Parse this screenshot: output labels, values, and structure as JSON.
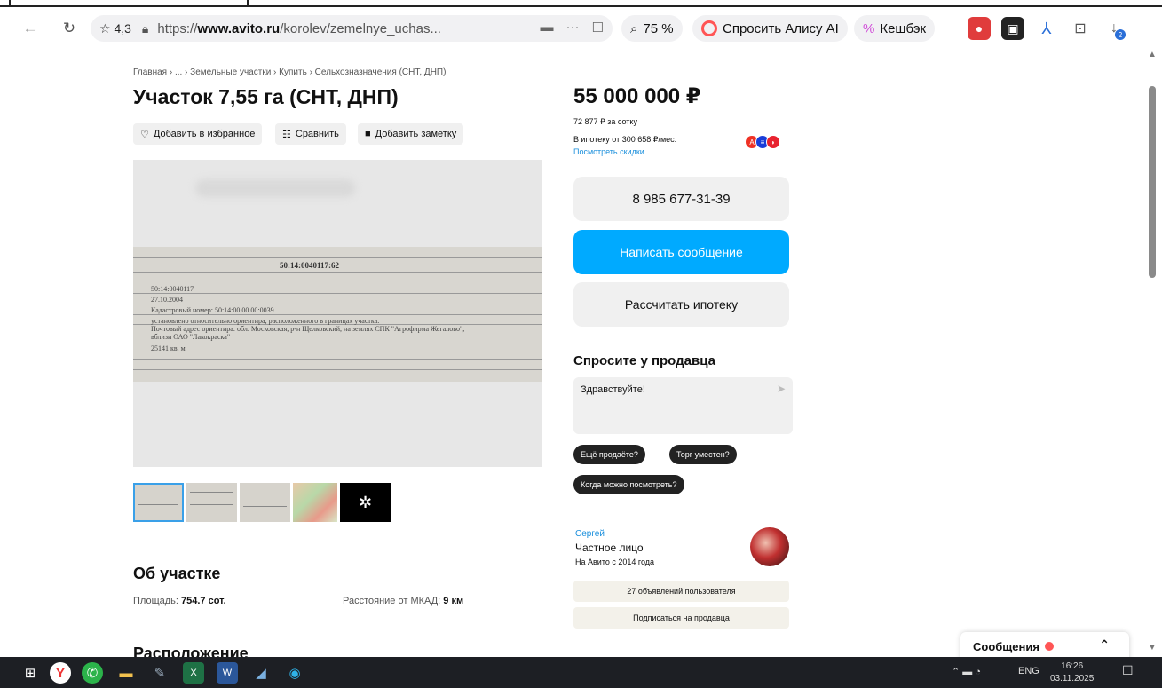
{
  "browser": {
    "rating": "4,3",
    "url_prefix": "https://",
    "url_domain": "www.avito.ru",
    "url_path": "/korolev/zemelnye_uchas...",
    "zoom": "75 %",
    "alice_label": "Спросить Алису AI",
    "cashback_label": "Кешбэк",
    "download_badge": "2"
  },
  "breadcrumb": "Главная › ... › Земельные участки › Купить › Сельхозназначения (СНТ, ДНП)",
  "title": "Участок 7,55 га (СНТ, ДНП)",
  "actions": {
    "favorite": "Добавить в избранное",
    "compare": "Сравнить",
    "note": "Добавить заметку"
  },
  "photo": {
    "kadastr_header": "50:14:0040117:62",
    "lines": [
      "50:14:0040117",
      "27.10.2004",
      "Кадастровый номер: 50:14:00 00 00:0039",
      "установлено относительно ориентира, расположенного в границах участка.",
      "Почтовый адрес ориентира: обл. Московская, р-н Щелковский, на землях СПК \"Агрофирма Жегалово\",",
      "вблизи ОАО \"Лакокраска\"",
      "25141 кв. м"
    ]
  },
  "about": {
    "title": "Об участке",
    "area_label": "Площадь:",
    "area_value": "754.7 сот.",
    "distance_label": "Расстояние от МКАД:",
    "distance_value": "9 км"
  },
  "location_title": "Расположение",
  "offer": {
    "price": "55 000 000 ₽",
    "per_sotka": "72 877 ₽ за сотку",
    "mortgage": "В ипотеку от 300 658 ₽/мес.",
    "discounts_link": "Посмотреть скидки",
    "phone": "8 985 677-31-39",
    "write_label": "Написать сообщение",
    "mortgage_calc_label": "Рассчитать ипотеку"
  },
  "ask": {
    "title": "Спросите у продавца",
    "message": "Здравствуйте!",
    "chips": [
      "Ещё продаёте?",
      "Торг уместен?",
      "Когда можно посмотреть?"
    ]
  },
  "seller": {
    "name": "Сергей",
    "type": "Частное лицо",
    "since": "На Авито с 2014 года",
    "listings_label": "27 объявлений пользователя",
    "subscribe_label": "Подписаться на продавца"
  },
  "messages_widget": {
    "label": "Сообщения"
  },
  "taskbar": {
    "lang": "ENG",
    "time": "16:26",
    "date": "03.11.2025"
  }
}
